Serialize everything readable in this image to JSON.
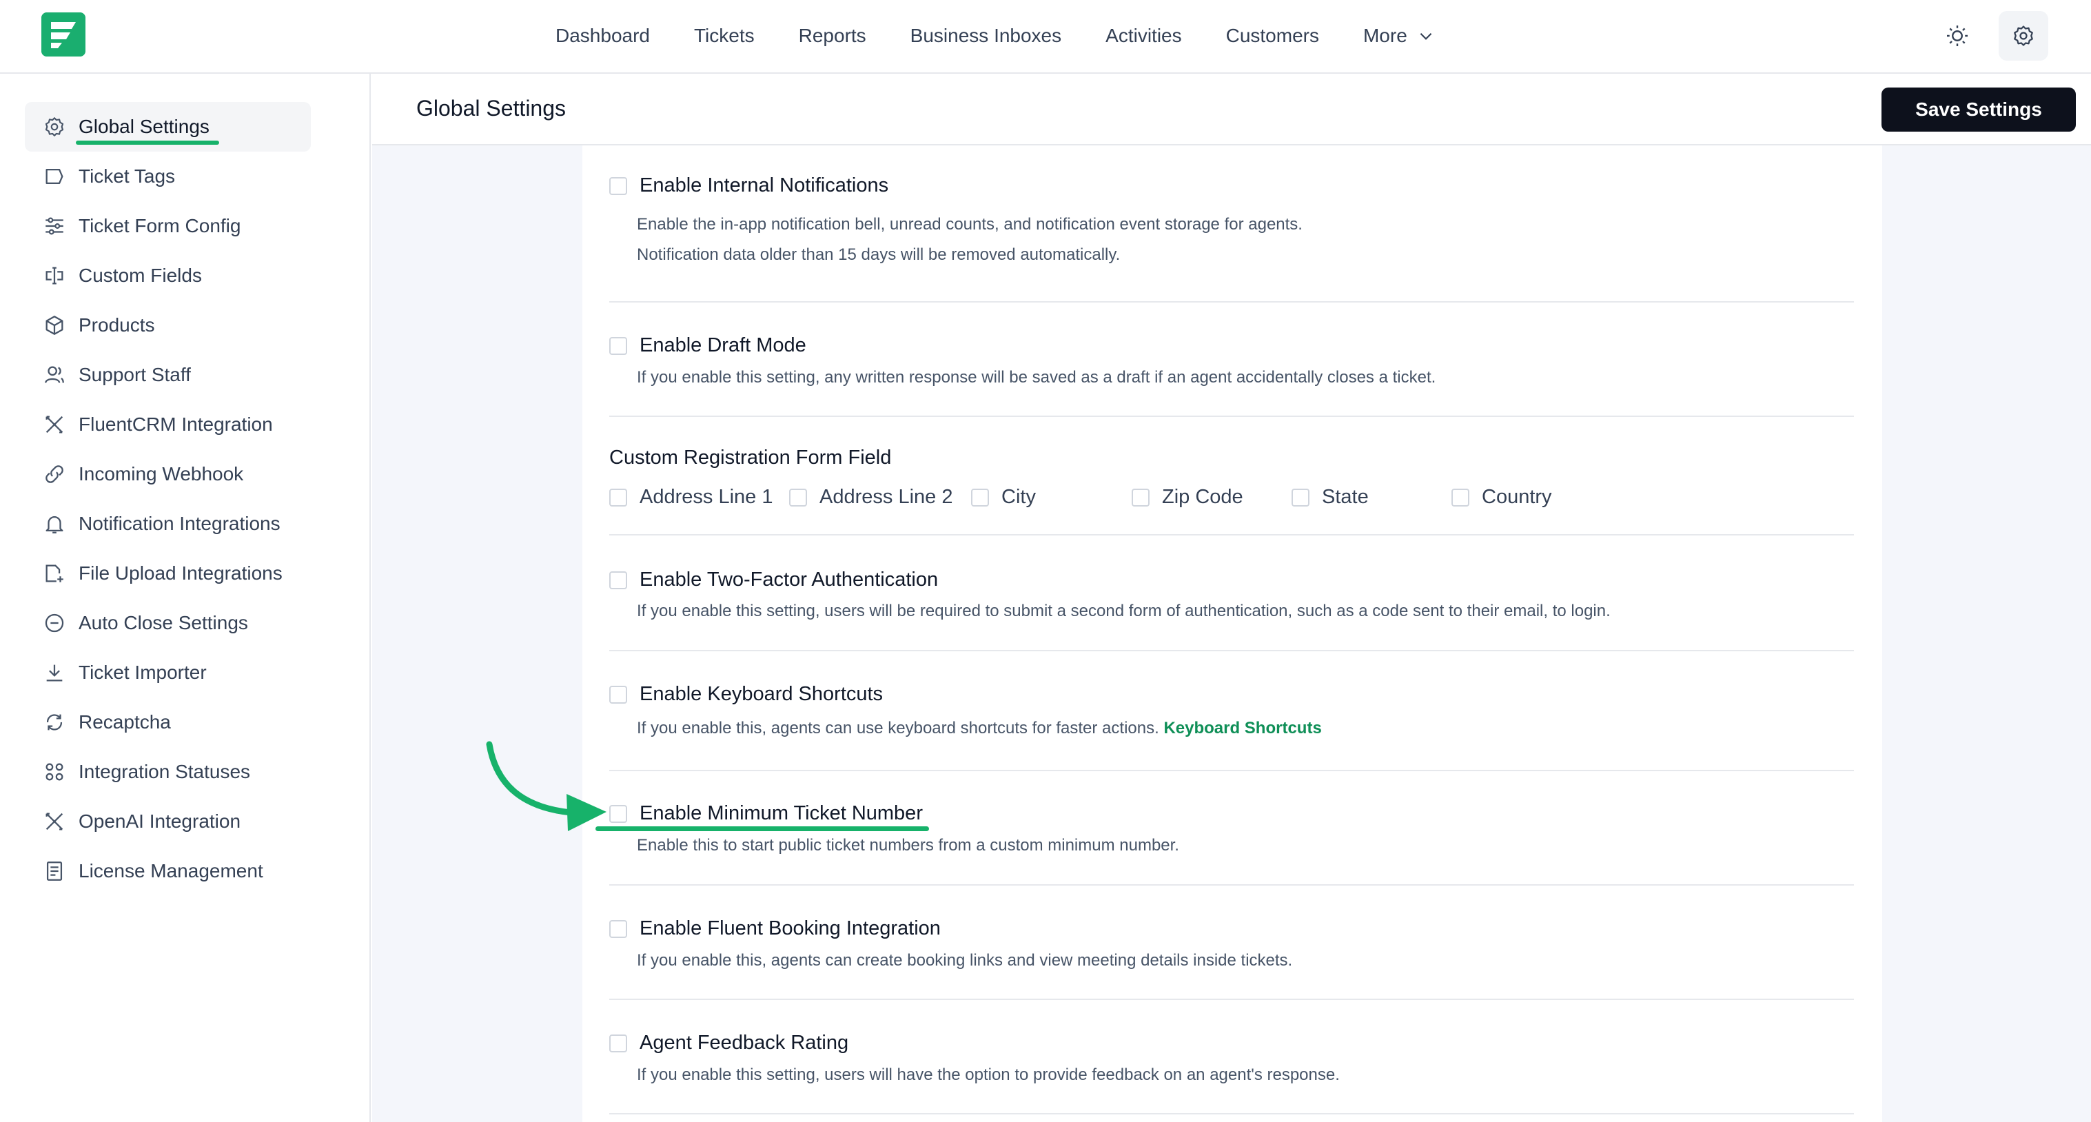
{
  "nav": {
    "items": [
      "Dashboard",
      "Tickets",
      "Reports",
      "Business Inboxes",
      "Activities",
      "Customers"
    ],
    "more_label": "More"
  },
  "sidebar": {
    "items": [
      {
        "label": "Global Settings",
        "icon": "gear-icon"
      },
      {
        "label": "Ticket Tags",
        "icon": "tag-icon"
      },
      {
        "label": "Ticket Form Config",
        "icon": "sliders-icon"
      },
      {
        "label": "Custom Fields",
        "icon": "custom-fields-icon"
      },
      {
        "label": "Products",
        "icon": "box-icon"
      },
      {
        "label": "Support Staff",
        "icon": "users-icon"
      },
      {
        "label": "FluentCRM Integration",
        "icon": "tools-icon"
      },
      {
        "label": "Incoming Webhook",
        "icon": "webhook-icon"
      },
      {
        "label": "Notification Integrations",
        "icon": "bell-icon"
      },
      {
        "label": "File Upload Integrations",
        "icon": "file-upload-icon"
      },
      {
        "label": "Auto Close Settings",
        "icon": "minus-circle-icon"
      },
      {
        "label": "Ticket Importer",
        "icon": "download-icon"
      },
      {
        "label": "Recaptcha",
        "icon": "refresh-icon"
      },
      {
        "label": "Integration Statuses",
        "icon": "grid-icon"
      },
      {
        "label": "OpenAI Integration",
        "icon": "tools-icon"
      },
      {
        "label": "License Management",
        "icon": "document-icon"
      }
    ]
  },
  "header": {
    "title": "Global Settings",
    "save_label": "Save Settings"
  },
  "settings": {
    "internal_notifications": {
      "title": "Enable Internal Notifications",
      "desc1": "Enable the in-app notification bell, unread counts, and notification event storage for agents.",
      "desc2": "Notification data older than 15 days will be removed automatically."
    },
    "draft_mode": {
      "title": "Enable Draft Mode",
      "desc": "If you enable this setting, any written response will be saved as a draft if an agent accidentally closes a ticket."
    },
    "registration": {
      "title": "Custom Registration Form Field",
      "fields": [
        "Address Line 1",
        "Address Line 2",
        "City",
        "Zip Code",
        "State",
        "Country"
      ]
    },
    "two_factor": {
      "title": "Enable Two-Factor Authentication",
      "desc": "If you enable this setting, users will be required to submit a second form of authentication, such as a code sent to their email, to login."
    },
    "keyboard_shortcuts": {
      "title": "Enable Keyboard Shortcuts",
      "desc": "If you enable this, agents can use keyboard shortcuts for faster actions.",
      "link": "Keyboard Shortcuts"
    },
    "min_ticket_number": {
      "title": "Enable Minimum Ticket Number",
      "desc": "Enable this to start public ticket numbers from a custom minimum number."
    },
    "fluent_booking": {
      "title": "Enable Fluent Booking Integration",
      "desc": "If you enable this, agents can create booking links and view meeting details inside tickets."
    },
    "feedback_rating": {
      "title": "Agent Feedback Rating",
      "desc": "If you enable this setting, users will have the option to provide feedback on an agent's response."
    }
  },
  "colors": {
    "brand": "#1aae6f",
    "highlight": "#17b26a",
    "primary_button": "#0d111c",
    "link": "#0f8f57"
  }
}
